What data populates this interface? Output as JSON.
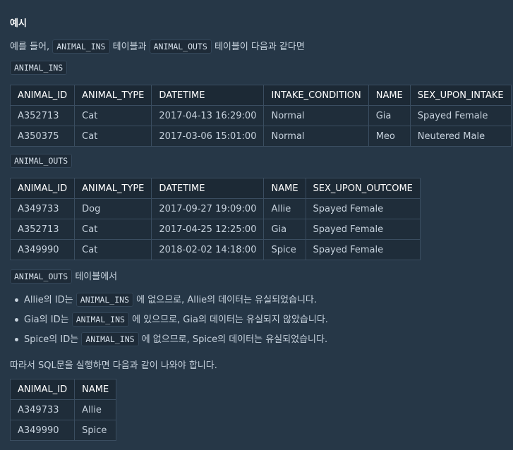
{
  "heading": "예시",
  "intro": {
    "prefix": "예를 들어,",
    "code1": "ANIMAL_INS",
    "mid": "테이블과",
    "code2": "ANIMAL_OUTS",
    "suffix": "테이블이 다음과 같다면"
  },
  "ins_label": "ANIMAL_INS",
  "ins_table": {
    "headers": [
      "ANIMAL_ID",
      "ANIMAL_TYPE",
      "DATETIME",
      "INTAKE_CONDITION",
      "NAME",
      "SEX_UPON_INTAKE"
    ],
    "rows": [
      [
        "A352713",
        "Cat",
        "2017-04-13 16:29:00",
        "Normal",
        "Gia",
        "Spayed Female"
      ],
      [
        "A350375",
        "Cat",
        "2017-03-06 15:01:00",
        "Normal",
        "Meo",
        "Neutered Male"
      ]
    ]
  },
  "outs_label": "ANIMAL_OUTS",
  "outs_table": {
    "headers": [
      "ANIMAL_ID",
      "ANIMAL_TYPE",
      "DATETIME",
      "NAME",
      "SEX_UPON_OUTCOME"
    ],
    "rows": [
      [
        "A349733",
        "Dog",
        "2017-09-27 19:09:00",
        "Allie",
        "Spayed Female"
      ],
      [
        "A352713",
        "Cat",
        "2017-04-25 12:25:00",
        "Gia",
        "Spayed Female"
      ],
      [
        "A349990",
        "Cat",
        "2018-02-02 14:18:00",
        "Spice",
        "Spayed Female"
      ]
    ]
  },
  "outs_note": {
    "code": "ANIMAL_OUTS",
    "text": "테이블에서"
  },
  "bullets": [
    {
      "pre": "Allie의 ID는",
      "code": "ANIMAL_INS",
      "post": "에 없으므로, Allie의 데이터는 유실되었습니다."
    },
    {
      "pre": "Gia의 ID는",
      "code": "ANIMAL_INS",
      "post": "에 있으므로, Gia의 데이터는 유실되지 않았습니다."
    },
    {
      "pre": "Spice의 ID는",
      "code": "ANIMAL_INS",
      "post": "에 없으므로, Spice의 데이터는 유실되었습니다."
    }
  ],
  "conclusion": "따라서 SQL문을 실행하면 다음과 같이 나와야 합니다.",
  "result_table": {
    "headers": [
      "ANIMAL_ID",
      "NAME"
    ],
    "rows": [
      [
        "A349733",
        "Allie"
      ],
      [
        "A349990",
        "Spice"
      ]
    ]
  }
}
